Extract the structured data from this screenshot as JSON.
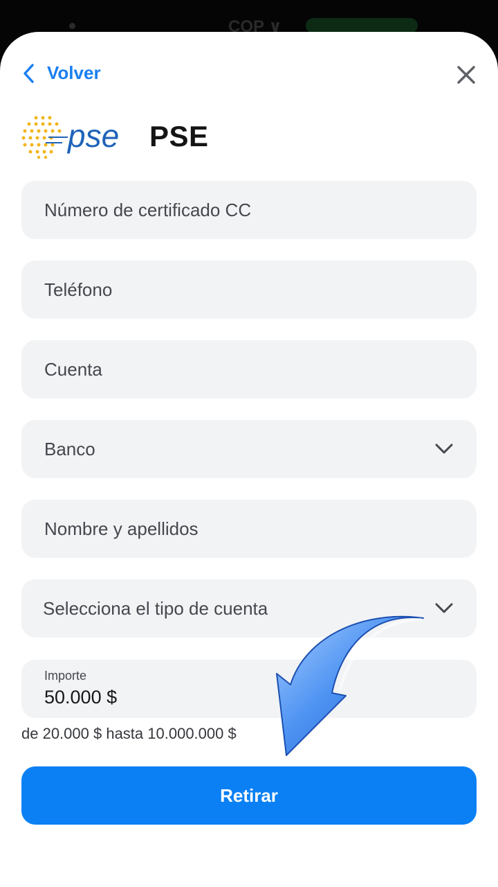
{
  "status_bar": {
    "currency": "COP ∨"
  },
  "header": {
    "back_label": "Volver"
  },
  "brand": {
    "logo_text": "pse",
    "title": "PSE"
  },
  "form": {
    "certificate_placeholder": "Número de certificado CC",
    "phone_placeholder": "Teléfono",
    "account_placeholder": "Cuenta",
    "bank_select": "Banco",
    "name_placeholder": "Nombre y apellidos",
    "account_type_select": "Selecciona el tipo de cuenta",
    "amount": {
      "label": "Importe",
      "value": "50.000 $"
    },
    "amount_hint": "de 20.000 $ hasta 10.000.000 $"
  },
  "actions": {
    "submit_label": "Retirar"
  },
  "colors": {
    "accent": "#0a80f4",
    "link": "#1a7ff0",
    "field_bg": "#f2f3f5",
    "logo_dots": "#f2b51c",
    "logo_text": "#1f63b8"
  }
}
